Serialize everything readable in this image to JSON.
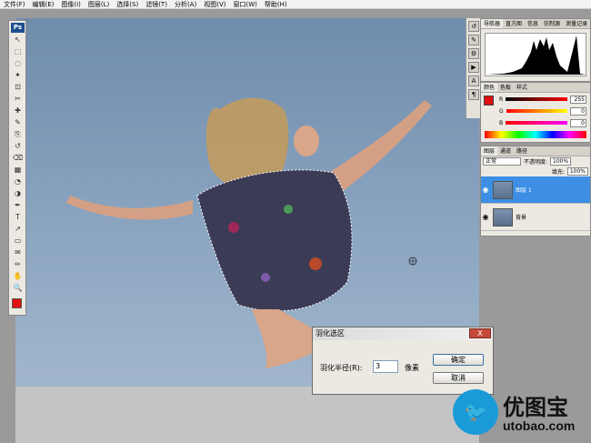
{
  "menu": [
    "文件(F)",
    "编辑(E)",
    "图像(I)",
    "图层(L)",
    "选择(S)",
    "滤镜(T)",
    "分析(A)",
    "视图(V)",
    "窗口(W)",
    "帮助(H)"
  ],
  "toolbox": {
    "logo": "Ps",
    "tools": [
      "move-tool-icon",
      "marquee-tool-icon",
      "lasso-tool-icon",
      "magic-wand-icon",
      "crop-tool-icon",
      "slice-tool-icon",
      "healing-brush-icon",
      "brush-tool-icon",
      "clone-stamp-icon",
      "history-brush-icon",
      "eraser-icon",
      "gradient-icon",
      "blur-icon",
      "dodge-icon",
      "pen-tool-icon",
      "type-tool-icon",
      "path-select-icon",
      "shape-tool-icon",
      "notes-icon",
      "eyedropper-icon",
      "hand-tool-icon",
      "zoom-tool-icon"
    ],
    "foreground_color": "#e01010"
  },
  "histogram_panel": {
    "tabs": [
      "导航器",
      "直方图",
      "信息",
      "仿制源",
      "测量记录"
    ]
  },
  "color_panel": {
    "tabs": [
      "颜色",
      "色板",
      "样式"
    ],
    "channels": [
      {
        "label": "R",
        "value": "255",
        "gradient": "linear-gradient(90deg,#000,#f00)"
      },
      {
        "label": "G",
        "value": "0",
        "gradient": "linear-gradient(90deg,#f00,#ff0)"
      },
      {
        "label": "B",
        "value": "0",
        "gradient": "linear-gradient(90deg,#f00,#f0f)"
      }
    ],
    "swatch": "#e01010"
  },
  "layers_panel": {
    "tabs": [
      "图层",
      "通道",
      "路径"
    ],
    "blend_mode": "正常",
    "opacity_label": "不透明度:",
    "opacity_value": "100%",
    "fill_label": "填充:",
    "fill_value": "100%",
    "layers": [
      {
        "name": "图层 1",
        "selected": true
      },
      {
        "name": "背景",
        "selected": false
      }
    ]
  },
  "dialog": {
    "title": "羽化选区",
    "close": "X",
    "radius_label": "羽化半径(R):",
    "radius_value": "3",
    "unit": "像素",
    "ok": "确定",
    "cancel": "取消"
  },
  "watermark": {
    "cn": "优图宝",
    "en": "utobao.com"
  }
}
